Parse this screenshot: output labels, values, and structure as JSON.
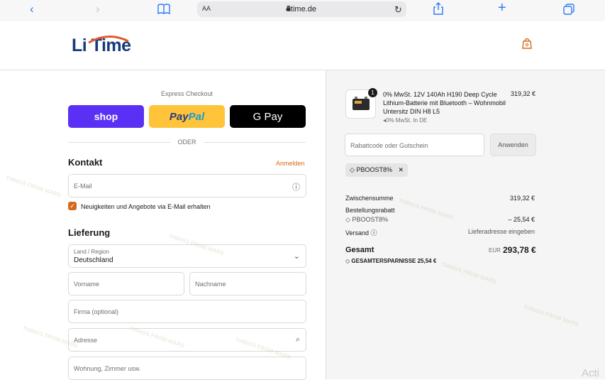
{
  "browser": {
    "aa": "AA",
    "url": "litime.de"
  },
  "brand": {
    "logo": "Li Time",
    "accent": "#163a7d",
    "arc": "#e05a2b"
  },
  "express": {
    "title": "Express Checkout",
    "shop": "shop",
    "paypal_pay": "Pay",
    "paypal_pal": "Pal",
    "gpay": "G Pay",
    "divider": "ODER"
  },
  "contact": {
    "title": "Kontakt",
    "login": "Anmelden",
    "email_placeholder": "E-Mail",
    "newsletter": "Neuigkeiten und Angebote via E-Mail erhalten"
  },
  "delivery": {
    "title": "Lieferung",
    "country_label": "Land / Region",
    "country_value": "Deutschland",
    "first_name": "Vorname",
    "last_name": "Nachname",
    "company": "Firma (optional)",
    "address": "Adresse",
    "apartment": "Wohnung, Zimmer usw."
  },
  "summary": {
    "product": {
      "qty": "1",
      "title": "0% MwSt. 12V 140Ah H190 Deep Cycle Lithium-Batterie mit Bluetooth – Wohnmobil Untersitz DIN H8 L5",
      "note": "0% MwSt. In DE",
      "price": "319,32 €"
    },
    "discount_placeholder": "Rabattcode oder Gutschein",
    "apply": "Anwenden",
    "code": "PBOOST8%",
    "subtotal_label": "Zwischensumme",
    "subtotal_value": "319,32 €",
    "order_discount_label": "Bestellungsrabatt",
    "code_line": "PBOOST8%",
    "discount_value": "– 25,54 €",
    "shipping_label": "Versand",
    "shipping_value": "Lieferadresse eingeben",
    "total_label": "Gesamt",
    "currency": "EUR",
    "total_value": "293,78 €",
    "savings": "GESAMTERSPARNISSE  25,54 €"
  },
  "watermark": "THINGS FROM MARS",
  "faint": "Acti"
}
